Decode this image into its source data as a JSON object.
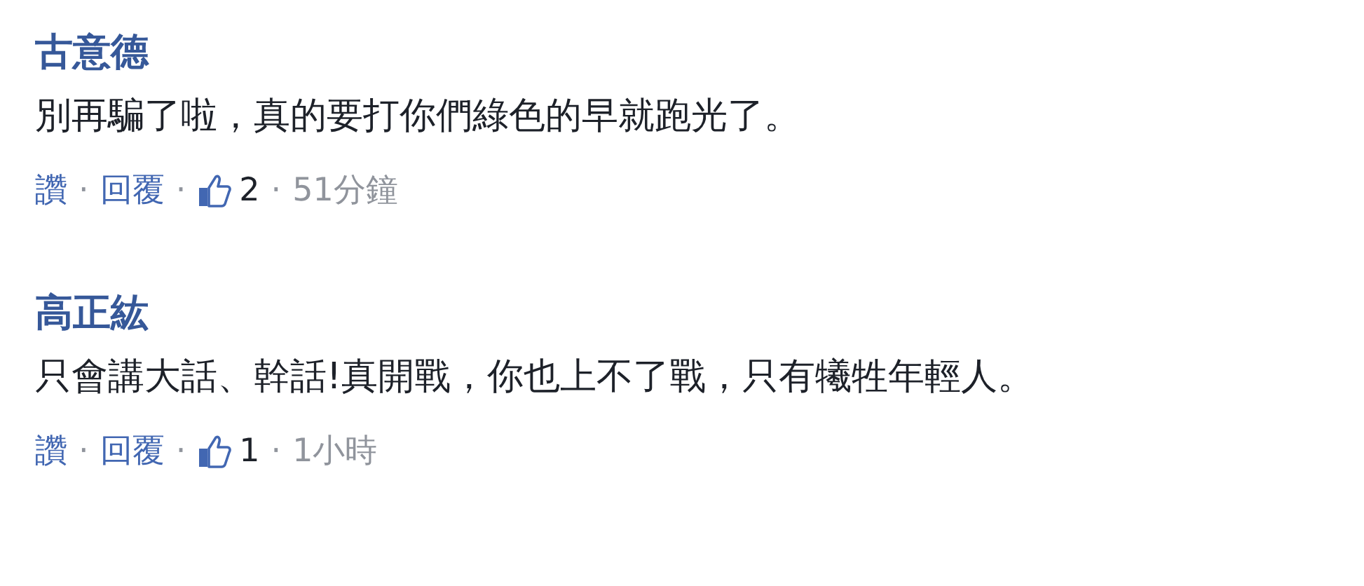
{
  "comments": [
    {
      "author": "古意德",
      "text": "別再騙了啦，真的要打你們綠色的早就跑光了。",
      "like_label": "讚",
      "reply_label": "回覆",
      "like_count": "2",
      "time": "51分鐘",
      "separator": "·"
    },
    {
      "author": "高正紘",
      "text": "只會講大話、幹話!真開戰，你也上不了戰，只有犧牲年輕人。",
      "like_label": "讚",
      "reply_label": "回覆",
      "like_count": "1",
      "time": "1小時",
      "separator": "·"
    }
  ]
}
